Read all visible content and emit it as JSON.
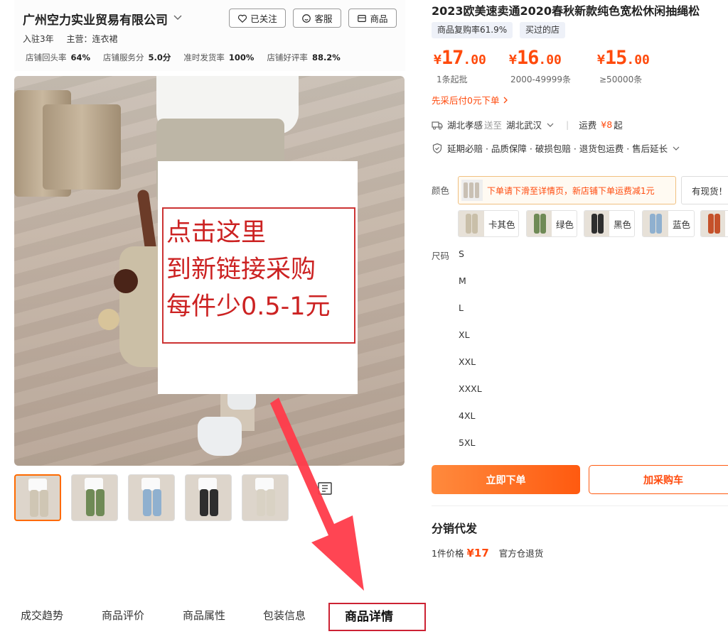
{
  "store": {
    "name": "广州空力实业贸易有限公司",
    "settled": "入驻3年",
    "main_category": "主营：连衣裙",
    "stats": [
      {
        "label": "店铺回头率",
        "value": "64%"
      },
      {
        "label": "店铺服务分",
        "value": "5.0分"
      },
      {
        "label": "准时发货率",
        "value": "100%"
      },
      {
        "label": "店铺好评率",
        "value": "88.2%"
      }
    ],
    "follow_label": "已关注",
    "service_label": "客服",
    "products_label": "商品"
  },
  "image_overlay": {
    "lines": [
      "点击这里",
      "到新链接采购",
      "每件少0.5-1元"
    ]
  },
  "thumbnails": [
    {
      "name": "khaki",
      "color": "#cfc6b4"
    },
    {
      "name": "green",
      "color": "#6f8a56"
    },
    {
      "name": "blue",
      "color": "#8fb0cf"
    },
    {
      "name": "black",
      "color": "#2e2e2e"
    },
    {
      "name": "beige",
      "color": "#d9d2c4"
    }
  ],
  "tabs": [
    "成交趋势",
    "商品评价",
    "商品属性",
    "包装信息",
    "商品详情"
  ],
  "active_tab": "商品详情",
  "product": {
    "title": "2023欧美速卖通2020春秋新款纯色宽松休闲抽绳松",
    "tags": [
      "商品复购率61.9%",
      "买过的店"
    ],
    "prices": [
      {
        "yen": "¥",
        "int": "17",
        "dec": ".00",
        "cond": "1条起批"
      },
      {
        "yen": "¥",
        "int": "16",
        "dec": ".00",
        "cond": "2000-49999条"
      },
      {
        "yen": "¥",
        "int": "15",
        "dec": ".00",
        "cond": "≥50000条"
      }
    ],
    "pay_later": "先采后付0元下单",
    "shipping": {
      "from": "湖北孝感",
      "to_label": "送至",
      "to": "湖北武汉",
      "fee_label": "运费",
      "fee": "¥8",
      "fee_suffix": "起"
    },
    "services": "延期必赔 · 品质保障 · 破损包赔 · 退货包运费 · 售后延长",
    "color_label": "颜色",
    "color_notice": "下单请下滑至详情页，新店铺下单运费减1元",
    "in_stock_label": "有现货！",
    "colors": [
      {
        "name": "卡其色",
        "swatch": "#c9bfa9"
      },
      {
        "name": "绿色",
        "swatch": "#6f8a56"
      },
      {
        "name": "黑色",
        "swatch": "#2e2e2e"
      },
      {
        "name": "蓝色",
        "swatch": "#8fb0cf"
      },
      {
        "name": "",
        "swatch": "#c5512a"
      }
    ],
    "size_label": "尺码",
    "sizes": [
      "S",
      "M",
      "L",
      "XL",
      "XXL",
      "XXXL",
      "4XL",
      "5XL"
    ],
    "order_button": "立即下单",
    "cart_button": "加采购车"
  },
  "distribution": {
    "title": "分销代发",
    "price_label": "1件价格",
    "price": "¥17",
    "returns": "官方仓退货"
  },
  "colors": {
    "accent": "#ff4a0c",
    "highlight_red": "#cc2233",
    "overlay_text": "#cc2222"
  }
}
